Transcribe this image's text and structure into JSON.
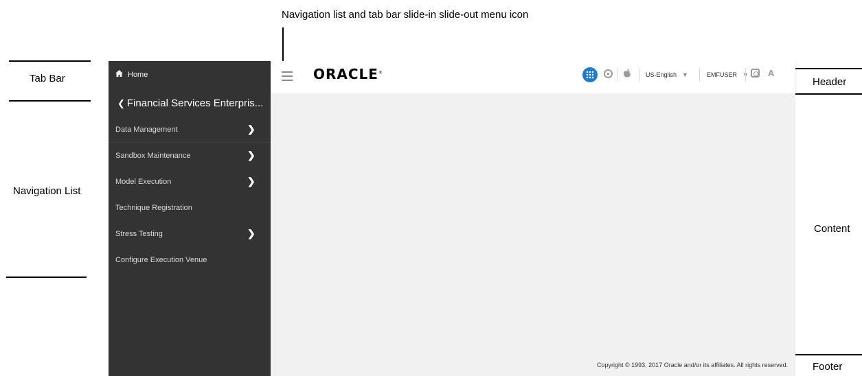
{
  "annotations": {
    "menu_icon_callout": "Navigation list and tab bar slide-in slide-out menu icon",
    "tab_bar": "Tab Bar",
    "navigation_list": "Navigation List",
    "header": "Header",
    "content": "Content",
    "footer": "Footer"
  },
  "nav": {
    "home": "Home",
    "breadcrumb": "Financial Services Enterpris...",
    "items": [
      {
        "label": "Data Management",
        "has_submenu": true
      },
      {
        "label": "Sandbox Maintenance",
        "has_submenu": true
      },
      {
        "label": "Model Execution",
        "has_submenu": true
      },
      {
        "label": "Technique Registration",
        "has_submenu": false
      },
      {
        "label": "Stress Testing",
        "has_submenu": true
      },
      {
        "label": "Configure Execution Venue",
        "has_submenu": false
      }
    ],
    "chevron": "❯"
  },
  "header": {
    "logo": "ORACLE",
    "language": "US-English",
    "user": "EMFUSER",
    "caret": "▼",
    "icons": [
      "menu-icon",
      "apps-grid-icon",
      "lock-icon",
      "apple-icon",
      "help-icon",
      "accessibility-icon"
    ],
    "apps_icon_color": "#1b7ad1"
  },
  "footer": {
    "copyright": "Copyright © 1993, 2017 Oracle and/or its affiliates. All rights reserved."
  },
  "colors": {
    "nav_background": "#333333",
    "content_background": "#f1f1f1"
  }
}
